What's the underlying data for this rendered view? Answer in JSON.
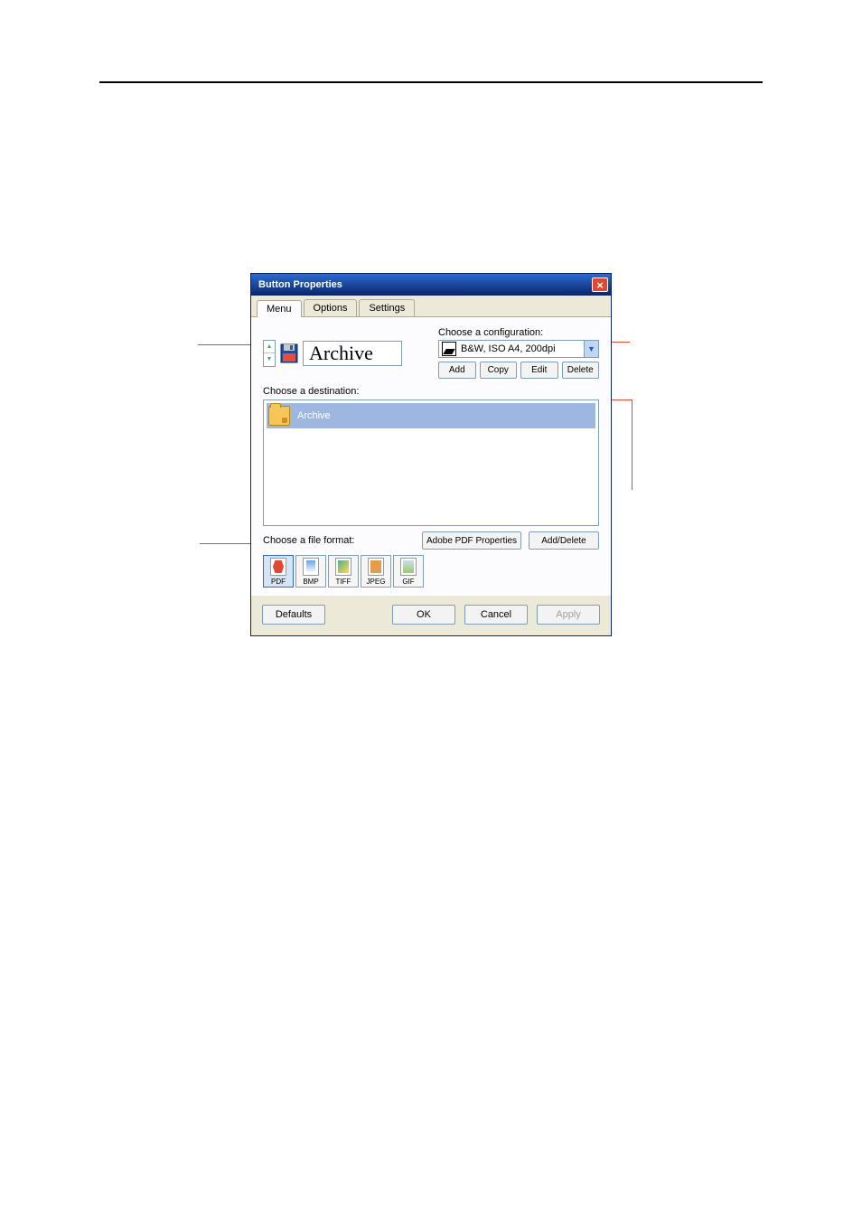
{
  "dialog": {
    "title": "Button Properties",
    "tabs": {
      "menu": "Menu",
      "options": "Options",
      "settings": "Settings"
    },
    "button_name": "Archive",
    "config": {
      "label": "Choose a configuration:",
      "selected": "B&W, ISO A4, 200dpi",
      "buttons": {
        "add": "Add",
        "copy": "Copy",
        "edit": "Edit",
        "delete": "Delete"
      }
    },
    "destination": {
      "label": "Choose a destination:",
      "items": [
        {
          "label": "Archive"
        }
      ]
    },
    "file_format": {
      "label": "Choose a file format:",
      "pdf_props": "Adobe PDF Properties",
      "add_delete": "Add/Delete",
      "formats": {
        "pdf": "PDF",
        "bmp": "BMP",
        "tiff": "TIFF",
        "jpeg": "JPEG",
        "gif": "GIF"
      }
    },
    "bottom": {
      "defaults": "Defaults",
      "ok": "OK",
      "cancel": "Cancel",
      "apply": "Apply"
    }
  }
}
